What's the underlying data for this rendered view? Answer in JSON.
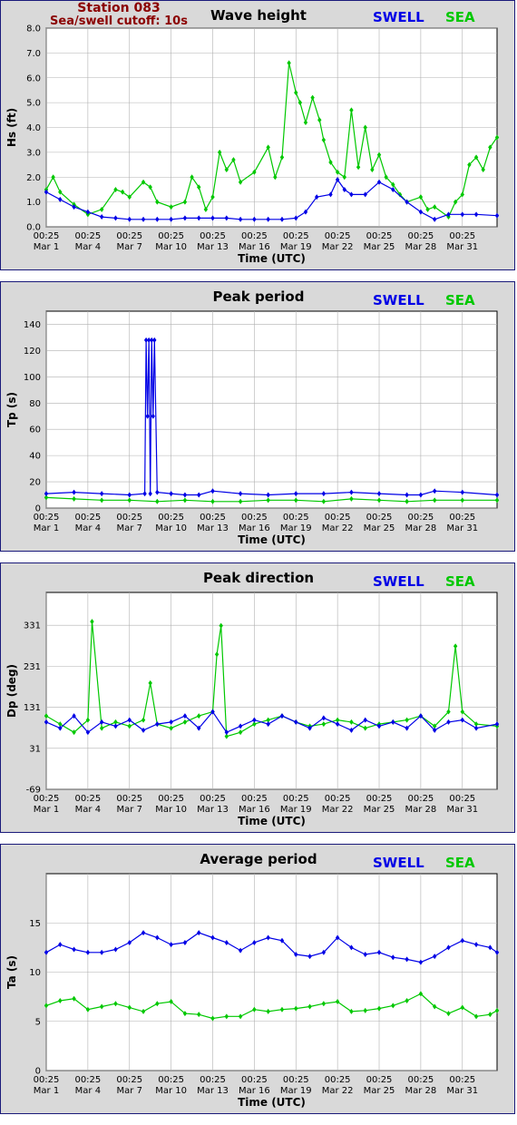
{
  "header": {
    "station": "Station 083",
    "cutoff": "Sea/swell cutoff: 10s"
  },
  "legend": {
    "swell": "SWELL",
    "sea": "SEA"
  },
  "colors": {
    "swell": "#0000e6",
    "sea": "#00c800",
    "title": "#8b0000",
    "panel_border": "#1a1a7a",
    "panel_bg": "#d9d9d9",
    "grid": "#b0b0b0"
  },
  "x_axis": {
    "label": "Time (UTC)",
    "range_days": [
      0,
      32.5
    ],
    "ticks": [
      {
        "day": 0,
        "line1": "00:25",
        "line2": "Mar 1"
      },
      {
        "day": 3,
        "line1": "00:25",
        "line2": "Mar 4"
      },
      {
        "day": 6,
        "line1": "00:25",
        "line2": "Mar 7"
      },
      {
        "day": 9,
        "line1": "00:25",
        "line2": "Mar 10"
      },
      {
        "day": 12,
        "line1": "00:25",
        "line2": "Mar 13"
      },
      {
        "day": 15,
        "line1": "00:25",
        "line2": "Mar 16"
      },
      {
        "day": 18,
        "line1": "00:25",
        "line2": "Mar 19"
      },
      {
        "day": 21,
        "line1": "00:25",
        "line2": "Mar 22"
      },
      {
        "day": 24,
        "line1": "00:25",
        "line2": "Mar 25"
      },
      {
        "day": 27,
        "line1": "00:25",
        "line2": "Mar 28"
      },
      {
        "day": 30,
        "line1": "00:25",
        "line2": "Mar 31"
      }
    ]
  },
  "chart_data": [
    {
      "type": "line",
      "title": "Wave height",
      "ylabel": "Hs (ft)",
      "ylim": [
        0,
        8
      ],
      "yticks": [
        "0.0",
        "1.0",
        "2.0",
        "3.0",
        "4.0",
        "5.0",
        "6.0",
        "7.0",
        "8.0"
      ],
      "ytick_values": [
        0,
        1,
        2,
        3,
        4,
        5,
        6,
        7,
        8
      ],
      "grid": true,
      "series": [
        {
          "name": "SWELL",
          "x": [
            0,
            1,
            2,
            3,
            4,
            5,
            6,
            7,
            8,
            9,
            10,
            11,
            12,
            13,
            14,
            15,
            16,
            17,
            18,
            18.7,
            19.5,
            20.5,
            21,
            21.5,
            22,
            23,
            24,
            25,
            26,
            27,
            28,
            29,
            30,
            31,
            32.5
          ],
          "values": [
            1.4,
            1.1,
            0.8,
            0.6,
            0.4,
            0.35,
            0.3,
            0.3,
            0.3,
            0.3,
            0.35,
            0.35,
            0.35,
            0.35,
            0.3,
            0.3,
            0.3,
            0.3,
            0.35,
            0.6,
            1.2,
            1.3,
            1.9,
            1.5,
            1.3,
            1.3,
            1.8,
            1.5,
            1.0,
            0.6,
            0.3,
            0.5,
            0.5,
            0.5,
            0.45
          ]
        },
        {
          "name": "SEA",
          "x": [
            0,
            0.5,
            1,
            2,
            3,
            4,
            5,
            5.5,
            6,
            7,
            7.5,
            8,
            9,
            10,
            10.5,
            11,
            11.5,
            12,
            12.5,
            13,
            13.5,
            14,
            15,
            16,
            16.5,
            17,
            17.5,
            18,
            18.3,
            18.7,
            19.2,
            19.7,
            20,
            20.5,
            21,
            21.5,
            22,
            22.5,
            23,
            23.5,
            24,
            24.5,
            25,
            25.5,
            26,
            27,
            27.5,
            28,
            29,
            29.5,
            30,
            30.5,
            31,
            31.5,
            32,
            32.5
          ],
          "values": [
            1.5,
            2.0,
            1.4,
            0.9,
            0.5,
            0.7,
            1.5,
            1.4,
            1.2,
            1.8,
            1.6,
            1.0,
            0.8,
            1.0,
            2.0,
            1.6,
            0.7,
            1.2,
            3.0,
            2.3,
            2.7,
            1.8,
            2.2,
            3.2,
            2.0,
            2.8,
            6.6,
            5.4,
            5.0,
            4.2,
            5.2,
            4.3,
            3.5,
            2.6,
            2.2,
            2.0,
            4.7,
            2.4,
            4.0,
            2.3,
            2.9,
            2.0,
            1.7,
            1.3,
            1.0,
            1.2,
            0.7,
            0.8,
            0.4,
            1.0,
            1.3,
            2.5,
            2.8,
            2.3,
            3.2,
            3.6
          ]
        }
      ]
    },
    {
      "type": "line",
      "title": "Peak period",
      "ylabel": "Tp (s)",
      "ylim": [
        0,
        150
      ],
      "yticks": [
        "0",
        "20",
        "40",
        "60",
        "80",
        "100",
        "120",
        "140"
      ],
      "ytick_values": [
        0,
        20,
        40,
        60,
        80,
        100,
        120,
        140
      ],
      "grid": true,
      "series": [
        {
          "name": "SWELL",
          "x": [
            0,
            2,
            4,
            6,
            7.1,
            7.2,
            7.3,
            7.4,
            7.5,
            7.6,
            7.7,
            7.8,
            8,
            9,
            10,
            11,
            12,
            14,
            16,
            18,
            20,
            22,
            24,
            26,
            27,
            28,
            30,
            32.5
          ],
          "values": [
            11,
            12,
            11,
            10,
            11,
            128,
            70,
            128,
            11,
            128,
            70,
            128,
            12,
            11,
            10,
            10,
            13,
            11,
            10,
            11,
            11,
            12,
            11,
            10,
            10,
            13,
            12,
            10
          ]
        },
        {
          "name": "SEA",
          "x": [
            0,
            2,
            4,
            6,
            8,
            10,
            12,
            14,
            16,
            18,
            20,
            22,
            24,
            26,
            28,
            30,
            32.5
          ],
          "values": [
            8,
            7,
            6,
            6,
            5,
            6,
            5,
            5,
            6,
            6,
            5,
            7,
            6,
            5,
            6,
            6,
            6
          ]
        }
      ]
    },
    {
      "type": "scatter",
      "title": "Peak direction",
      "ylabel": "Dp (deg)",
      "ylim": [
        -69,
        411
      ],
      "yticks": [
        "-69",
        "31",
        "131",
        "231",
        "331"
      ],
      "ytick_values": [
        -69,
        31,
        131,
        231,
        331
      ],
      "grid": true,
      "series": [
        {
          "name": "SWELL",
          "x": [
            0,
            1,
            2,
            3,
            4,
            5,
            6,
            7,
            8,
            9,
            10,
            11,
            12,
            13,
            14,
            15,
            16,
            17,
            18,
            19,
            20,
            21,
            22,
            23,
            24,
            25,
            26,
            27,
            28,
            29,
            30,
            31,
            32.5
          ],
          "values": [
            95,
            80,
            110,
            70,
            95,
            85,
            100,
            75,
            90,
            95,
            110,
            80,
            120,
            70,
            85,
            100,
            90,
            110,
            95,
            80,
            105,
            90,
            75,
            100,
            85,
            95,
            80,
            110,
            75,
            95,
            100,
            80,
            90
          ]
        },
        {
          "name": "SEA",
          "x": [
            0,
            1,
            2,
            3,
            3.3,
            4,
            5,
            6,
            7,
            7.5,
            8,
            9,
            10,
            11,
            12,
            12.3,
            12.6,
            13,
            14,
            15,
            16,
            17,
            18,
            19,
            20,
            21,
            22,
            23,
            24,
            25,
            26,
            27,
            28,
            29,
            29.5,
            30,
            31,
            32.5
          ],
          "values": [
            110,
            90,
            70,
            100,
            340,
            80,
            95,
            85,
            100,
            190,
            90,
            80,
            95,
            110,
            120,
            260,
            330,
            60,
            70,
            90,
            100,
            110,
            95,
            85,
            90,
            100,
            95,
            80,
            90,
            95,
            100,
            110,
            85,
            120,
            280,
            120,
            90,
            85
          ]
        }
      ]
    },
    {
      "type": "line",
      "title": "Average period",
      "ylabel": "Ta (s)",
      "ylim": [
        0,
        20
      ],
      "yticks": [
        "0",
        "5",
        "10",
        "15"
      ],
      "ytick_values": [
        0,
        5,
        10,
        15
      ],
      "grid": true,
      "series": [
        {
          "name": "SWELL",
          "x": [
            0,
            1,
            2,
            3,
            4,
            5,
            6,
            7,
            8,
            9,
            10,
            11,
            12,
            13,
            14,
            15,
            16,
            17,
            18,
            19,
            20,
            21,
            22,
            23,
            24,
            25,
            26,
            27,
            28,
            29,
            30,
            31,
            32,
            32.5
          ],
          "values": [
            12.0,
            12.8,
            12.3,
            12.0,
            12.0,
            12.3,
            13.0,
            14.0,
            13.5,
            12.8,
            13.0,
            14.0,
            13.5,
            13.0,
            12.2,
            13.0,
            13.5,
            13.2,
            11.8,
            11.6,
            12.0,
            13.5,
            12.5,
            11.8,
            12.0,
            11.5,
            11.3,
            11.0,
            11.6,
            12.5,
            13.2,
            12.8,
            12.5,
            12.0
          ]
        },
        {
          "name": "SEA",
          "x": [
            0,
            1,
            2,
            3,
            4,
            5,
            6,
            7,
            8,
            9,
            10,
            11,
            12,
            13,
            14,
            15,
            16,
            17,
            18,
            19,
            20,
            21,
            22,
            23,
            24,
            25,
            26,
            27,
            28,
            29,
            30,
            31,
            32,
            32.5
          ],
          "values": [
            6.6,
            7.1,
            7.3,
            6.2,
            6.5,
            6.8,
            6.4,
            6.0,
            6.8,
            7.0,
            5.8,
            5.7,
            5.3,
            5.5,
            5.5,
            6.2,
            6.0,
            6.2,
            6.3,
            6.5,
            6.8,
            7.0,
            6.0,
            6.1,
            6.3,
            6.6,
            7.1,
            7.8,
            6.5,
            5.8,
            6.4,
            5.5,
            5.7,
            6.1
          ]
        }
      ]
    }
  ]
}
